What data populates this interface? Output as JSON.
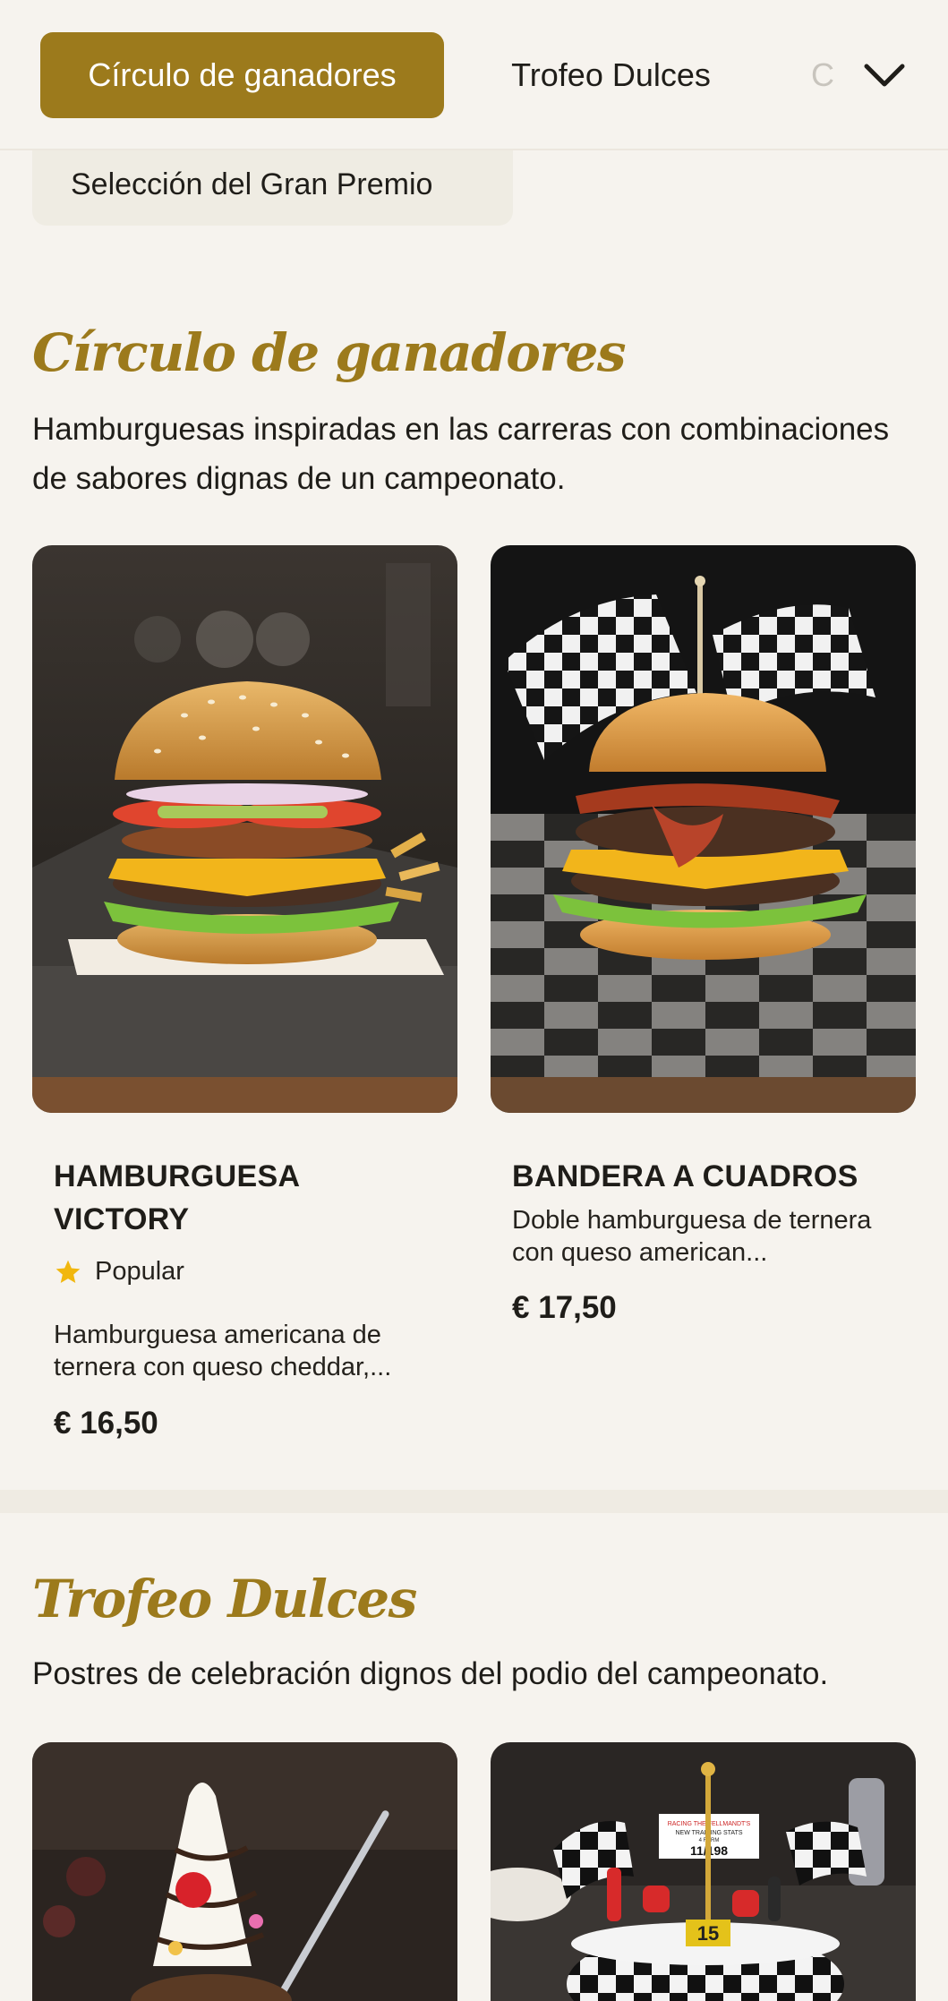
{
  "nav": {
    "tabs": [
      {
        "label": "Círculo de ganadores",
        "active": true
      },
      {
        "label": "Trofeo Dulces",
        "active": false
      },
      {
        "label": "C",
        "active": false
      }
    ],
    "more_icon": "chevron-down-icon",
    "sub_tab": "Selección del Gran Premio"
  },
  "colors": {
    "accent": "#9c7a1c",
    "background": "#f6f3ee",
    "star": "#f1b70e"
  },
  "sections": [
    {
      "title": "Círculo de ganadores",
      "description": "Hamburguesas inspiradas en las carreras con combinaciones de sabores dignas de un campeonato.",
      "items": [
        {
          "name": "HAMBURGUESA VICTORY",
          "badge": "Popular",
          "badge_icon": "star-icon",
          "description": "Hamburguesa americana de ternera con queso cheddar,...",
          "price": "€ 16,50"
        },
        {
          "name": "BANDERA A CUADROS",
          "description": "Doble hamburguesa de ternera con queso american...",
          "price": "€ 17,50"
        }
      ]
    },
    {
      "title": "Trofeo Dulces",
      "description": "Postres de celebración dignos del podio del campeonato.",
      "items": [
        {
          "image": "sundae-photo"
        },
        {
          "image": "checkered-cake-photo",
          "cake_text": [
            "RACING THE FELLMANDT'S",
            "NEW TRAINING STATS",
            "4 FORM",
            "11/198"
          ],
          "cake_number": "15"
        }
      ]
    }
  ]
}
